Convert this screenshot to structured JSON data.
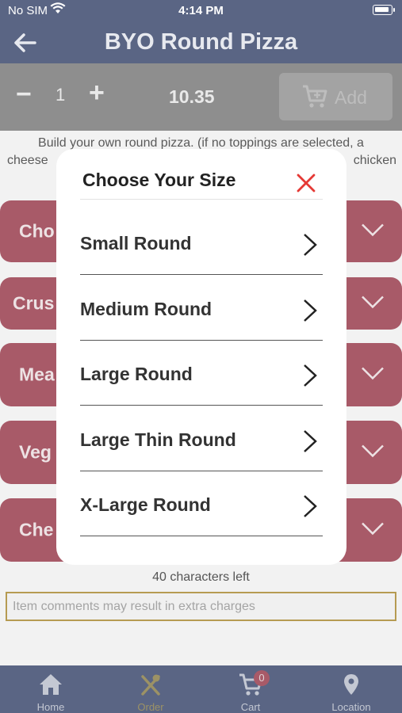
{
  "status": {
    "carrier": "No SIM",
    "time": "4:14 PM"
  },
  "header": {
    "title": "BYO Round Pizza",
    "back_icon": "arrow-left-icon"
  },
  "quantity": {
    "minus": "−",
    "value": "1",
    "plus": "+",
    "price": "10.35",
    "add_label": "Add"
  },
  "description": {
    "line1": "Build your own round pizza. (if no toppings are selected, a",
    "line2": "cheese",
    "line2_end": "chicken"
  },
  "sections": [
    {
      "label": "Cho"
    },
    {
      "label": "Crus"
    },
    {
      "label": "Mea"
    },
    {
      "label": "Veg"
    },
    {
      "label": "Che"
    }
  ],
  "comment": {
    "chars_left": "40 characters left",
    "placeholder": "Item comments may result in extra charges"
  },
  "tabs": [
    {
      "label": "Home",
      "icon": "home-icon"
    },
    {
      "label": "Order",
      "icon": "utensils-icon"
    },
    {
      "label": "Cart",
      "icon": "cart-icon",
      "badge": "0"
    },
    {
      "label": "Location",
      "icon": "location-pin-icon"
    }
  ],
  "modal": {
    "title": "Choose Your Size",
    "options": [
      {
        "label": "Small Round"
      },
      {
        "label": "Medium Round"
      },
      {
        "label": "Large Round"
      },
      {
        "label": "Large Thin Round"
      },
      {
        "label": "X-Large Round"
      }
    ]
  },
  "colors": {
    "header": "#5a6584",
    "accent": "#a85a68",
    "close": "#e53935"
  }
}
